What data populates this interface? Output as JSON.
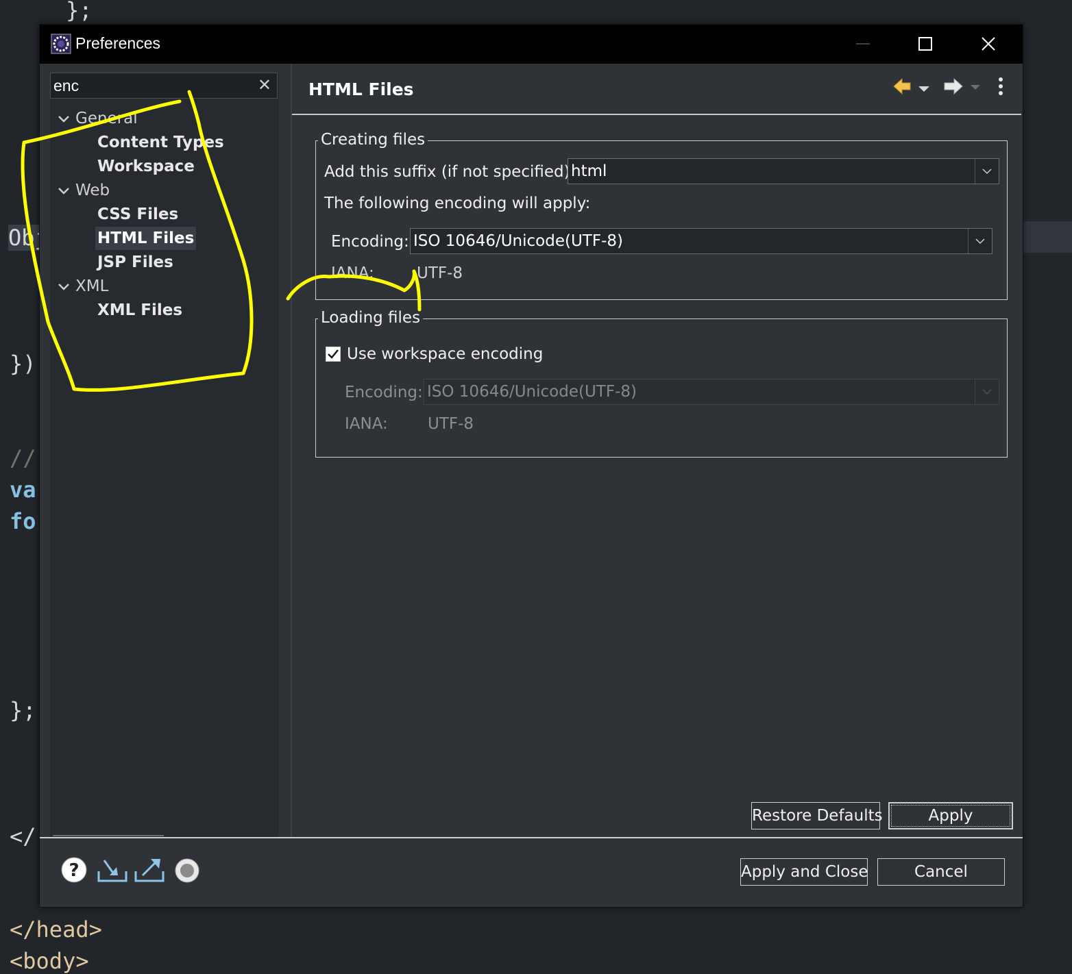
{
  "editor": {
    "line_top": "};",
    "line_obj": "Obj",
    "line_close1": "})",
    "line_comment": "//",
    "line_var": "var",
    "line_for": "for",
    "line_close2": "};",
    "line_tag": "</",
    "line_head": "</head>",
    "line_body": "<body>"
  },
  "window": {
    "title": "Preferences",
    "app_icon": "eclipse-icon",
    "minimize_icon": "minimize-icon",
    "maximize_icon": "maximize-icon",
    "close_icon": "close-icon"
  },
  "sidebar": {
    "filter_value": "enc",
    "clear_icon": "clear-icon",
    "tree": [
      {
        "label": "General",
        "expanded": true,
        "children": [
          "Content Types",
          "Workspace"
        ]
      },
      {
        "label": "Web",
        "expanded": true,
        "children": [
          "CSS Files",
          "HTML Files",
          "JSP Files"
        ]
      },
      {
        "label": "XML",
        "expanded": true,
        "children": [
          "XML Files"
        ]
      }
    ],
    "selected": "HTML Files"
  },
  "page": {
    "title": "HTML Files",
    "nav_icons": [
      "back-arrow-icon",
      "forward-arrow-icon",
      "more-vert-icon"
    ],
    "creating": {
      "group_title": "Creating files",
      "suffix_label": "Add this suffix (if not specified):",
      "suffix_value": "html",
      "apply_text": "The following encoding will apply:",
      "encoding_label": "Encoding:",
      "encoding_value": "ISO 10646/Unicode(UTF-8)",
      "iana_label": "IANA:",
      "iana_value": "UTF-8"
    },
    "loading": {
      "group_title": "Loading files",
      "checkbox_label": "Use workspace encoding",
      "checkbox_checked": true,
      "encoding_label": "Encoding:",
      "encoding_value": "ISO 10646/Unicode(UTF-8)",
      "iana_label": "IANA:",
      "iana_value": "UTF-8"
    },
    "restore_defaults": "Restore Defaults",
    "apply": "Apply"
  },
  "footer": {
    "icons": [
      "help-icon",
      "import-icon",
      "export-icon",
      "oomph-record-icon"
    ],
    "apply_and_close": "Apply and Close",
    "cancel": "Cancel"
  },
  "annotation": {
    "color": "#ffff00"
  }
}
